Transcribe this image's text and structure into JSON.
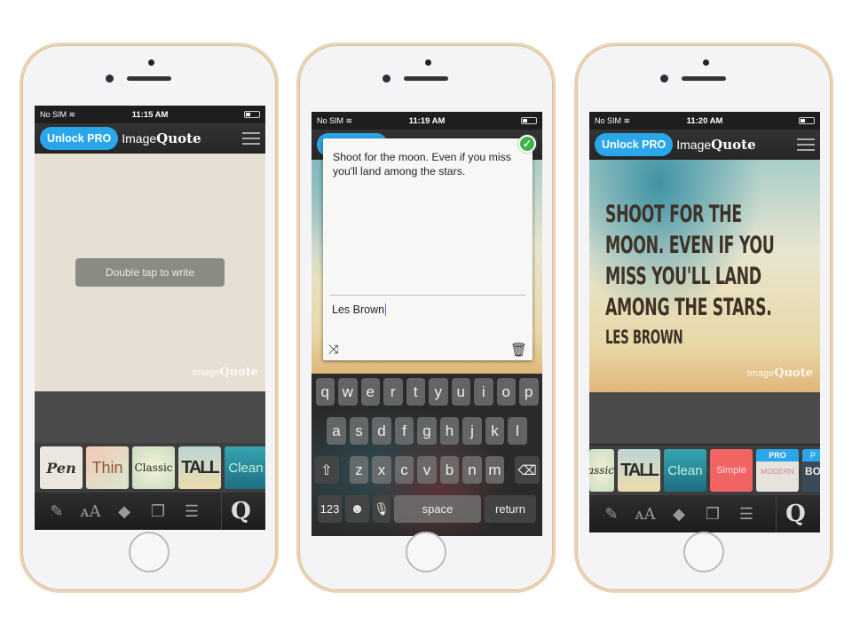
{
  "phones": [
    {
      "status": {
        "carrier": "No SIM",
        "time": "11:15 AM"
      },
      "header": {
        "unlock": "Unlock PRO",
        "brand_light": "Image",
        "brand_bold": "Quote"
      },
      "canvas": {
        "hint": "Double tap to write",
        "watermark_light": "Image",
        "watermark_bold": "Quote"
      },
      "styles": [
        "Pen",
        "Thin",
        "Classic",
        "TALL",
        "Clean"
      ]
    },
    {
      "status": {
        "carrier": "No SIM",
        "time": "11:19 AM"
      },
      "editor": {
        "quote": "Shoot for the moon. Even if you miss you'll land among the stars.",
        "author": "Les Brown"
      },
      "keyboard": {
        "row1": [
          "q",
          "w",
          "e",
          "r",
          "t",
          "y",
          "u",
          "i",
          "o",
          "p"
        ],
        "row2": [
          "a",
          "s",
          "d",
          "f",
          "g",
          "h",
          "j",
          "k",
          "l"
        ],
        "row3": [
          "z",
          "x",
          "c",
          "v",
          "b",
          "n",
          "m"
        ],
        "numbers": "123",
        "space": "space",
        "return": "return"
      }
    },
    {
      "status": {
        "carrier": "No SIM",
        "time": "11:20 AM"
      },
      "header": {
        "unlock": "Unlock PRO",
        "brand_light": "Image",
        "brand_bold": "Quote"
      },
      "canvas": {
        "quote_lines": [
          "SHOOT FOR THE",
          "MOON. EVEN IF YOU",
          "MISS YOU'LL LAND",
          "AMONG THE STARS."
        ],
        "author": "LES BROWN",
        "watermark_light": "Image",
        "watermark_bold": "Quote"
      },
      "styles": [
        "assic",
        "TALL",
        "Clean",
        "Simple",
        "MODERN",
        "BO"
      ],
      "pro_badge": "PRO",
      "pro_badge_short": "P"
    }
  ],
  "toolbar": {
    "icons": [
      "edit-icon",
      "font-size-icon",
      "paint-fill-icon",
      "layers-icon",
      "sliders-icon",
      "share-icon"
    ]
  },
  "colors": {
    "accent": "#2aa6ea",
    "simple": "#f26464",
    "frame": "#e9d3b3"
  }
}
